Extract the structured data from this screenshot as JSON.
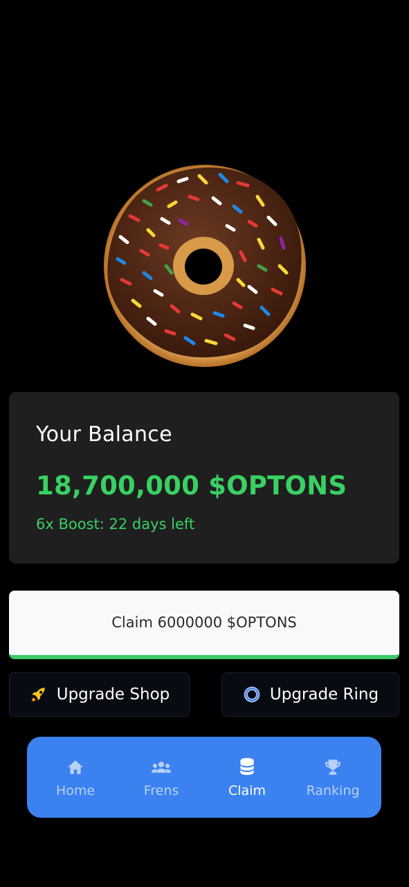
{
  "hero": {
    "image": "chocolate-sprinkle-donut"
  },
  "balance": {
    "label": "Your Balance",
    "amount": "18,700,000 $OPTONS",
    "boost": "6x Boost: 22 days left",
    "accent_color": "#39d163"
  },
  "claim": {
    "label": "Claim 6000000 $OPTONS",
    "accent_color": "#3ccb6a"
  },
  "upgrades": {
    "shop": {
      "label": "Upgrade Shop",
      "icon": "rocket-icon"
    },
    "ring": {
      "label": "Upgrade Ring",
      "icon": "ring-icon"
    }
  },
  "nav": {
    "items": [
      {
        "label": "Home",
        "icon": "home-icon",
        "active": false
      },
      {
        "label": "Frens",
        "icon": "users-icon",
        "active": false
      },
      {
        "label": "Claim",
        "icon": "coins-icon",
        "active": true
      },
      {
        "label": "Ranking",
        "icon": "trophy-icon",
        "active": false
      }
    ],
    "background": "#3b82f0"
  }
}
